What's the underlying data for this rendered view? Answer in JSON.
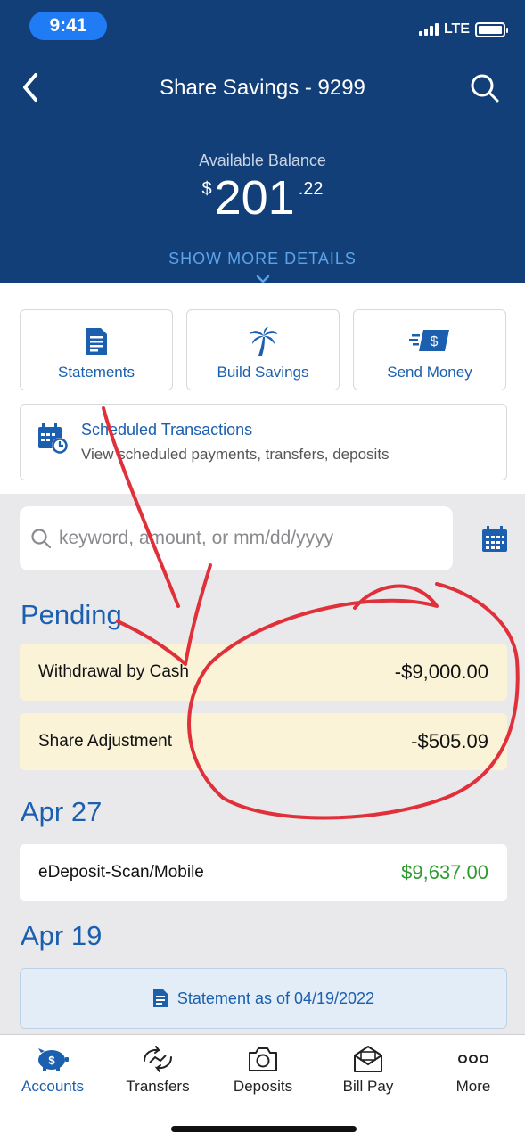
{
  "status_bar": {
    "time": "9:41",
    "network": "LTE"
  },
  "header": {
    "title": "Share Savings - 9299",
    "balance_label": "Available Balance",
    "balance_currency": "$",
    "balance_dollars": "201",
    "balance_cents": ".22",
    "show_more": "SHOW MORE DETAILS"
  },
  "quick_actions": [
    {
      "label": "Statements",
      "icon": "document-icon"
    },
    {
      "label": "Build Savings",
      "icon": "palm-tree-icon"
    },
    {
      "label": "Send Money",
      "icon": "money-send-icon"
    }
  ],
  "scheduled": {
    "title": "Scheduled Transactions",
    "subtitle": "View scheduled payments, transfers, deposits"
  },
  "search": {
    "placeholder": "keyword, amount, or mm/dd/yyyy"
  },
  "sections": [
    {
      "heading": "Pending",
      "rows": [
        {
          "label": "Withdrawal by Cash",
          "amount": "-$9,000.00"
        },
        {
          "label": "Share Adjustment",
          "amount": "-$505.09"
        }
      ]
    },
    {
      "heading": "Apr 27",
      "rows": [
        {
          "label": "eDeposit-Scan/Mobile",
          "amount": "$9,637.00"
        }
      ]
    },
    {
      "heading": "Apr 19",
      "statement_label": "Statement as of 04/19/2022"
    }
  ],
  "tabbar": [
    {
      "label": "Accounts",
      "icon": "piggy-bank-icon",
      "active": true
    },
    {
      "label": "Transfers",
      "icon": "transfer-icon",
      "active": false
    },
    {
      "label": "Deposits",
      "icon": "camera-icon",
      "active": false
    },
    {
      "label": "Bill Pay",
      "icon": "envelope-icon",
      "active": false
    },
    {
      "label": "More",
      "icon": "more-icon",
      "active": false
    }
  ],
  "colors": {
    "header_bg": "#123f78",
    "accent": "#1b5fae",
    "pending_bg": "#faf3d7",
    "positive": "#2f9b2f",
    "annotation": "#e0303a"
  }
}
